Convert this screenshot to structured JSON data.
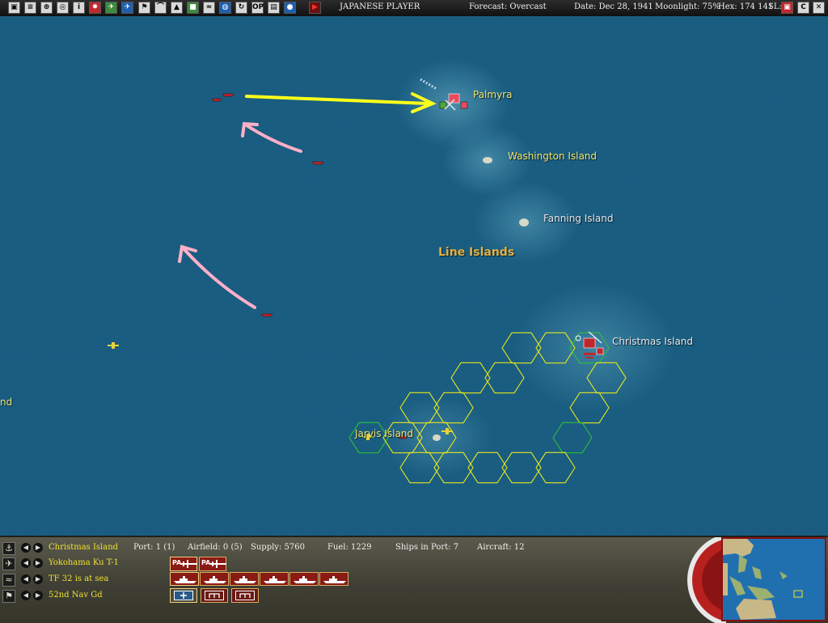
{
  "toolbar": {
    "buttons": [
      {
        "name": "menu",
        "glyph": "▣",
        "style": ""
      },
      {
        "name": "report",
        "glyph": "≡",
        "style": ""
      },
      {
        "name": "bases",
        "glyph": "⊕",
        "style": ""
      },
      {
        "name": "ships",
        "glyph": "◎",
        "style": ""
      },
      {
        "name": "info",
        "glyph": "i",
        "style": ""
      },
      {
        "name": "rising-sun",
        "glyph": "✸",
        "style": "red"
      },
      {
        "name": "air-groups",
        "glyph": "✈",
        "style": "green"
      },
      {
        "name": "aircraft",
        "glyph": "✈",
        "style": "blue"
      },
      {
        "name": "flag",
        "glyph": "⚑",
        "style": ""
      },
      {
        "name": "air-ops",
        "glyph": "⌒",
        "style": ""
      },
      {
        "name": "ground-units",
        "glyph": "▲",
        "style": ""
      },
      {
        "name": "land",
        "glyph": "■",
        "style": "green"
      },
      {
        "name": "fleet",
        "glyph": "≈",
        "style": ""
      },
      {
        "name": "globe",
        "glyph": "◍",
        "style": "blue"
      },
      {
        "name": "cycle",
        "glyph": "↻",
        "style": ""
      },
      {
        "name": "op",
        "glyph": "OP",
        "style": ""
      },
      {
        "name": "log",
        "glyph": "▤",
        "style": ""
      },
      {
        "name": "weather",
        "glyph": "●",
        "style": "blue"
      },
      {
        "name": "end-turn",
        "glyph": "▶",
        "style": "dark"
      }
    ],
    "player": "JAPANESE PLAYER",
    "forecast": "Forecast: Overcast",
    "date": "Date: Dec 28, 1941",
    "moonlight": "Moonlight: 75%",
    "hex": "Hex: 174 141",
    "sl": "SL:",
    "right_buttons": [
      "▣",
      "C",
      "✕"
    ]
  },
  "map": {
    "labels": {
      "palmyra": "Palmyra",
      "washington": "Washington Island",
      "fanning": "Fanning Island",
      "line_islands": "Line Islands",
      "christmas": "Christmas Island",
      "jarvis": "Jarvis Island",
      "edge": "nd"
    }
  },
  "panel": {
    "rows": [
      {
        "icon": "⚓",
        "name": "Christmas Island",
        "stats": {
          "port": "Port: 1 (1)",
          "airfield": "Airfield: 0 (5)",
          "supply": "Supply: 5760",
          "fuel": "Fuel: 1229",
          "ships": "Ships in Port: 7",
          "aircraft": "Aircraft: 12"
        }
      },
      {
        "icon": "✈",
        "name": "Yokohama Ku T-1"
      },
      {
        "icon": "≈",
        "name": "TF 32 is at sea"
      },
      {
        "icon": "⚑",
        "name": "52nd Nav Gd"
      }
    ],
    "air_tags": [
      "PA",
      "PA"
    ]
  },
  "colors": {
    "sea": "#1a5f83",
    "hex_yellow": "#e6e81e",
    "hex_green": "#2fbf3a",
    "arrow_yellow": "#ffff1a",
    "arrow_pink": "#ffb0c8",
    "japan_red": "#c0272d"
  }
}
